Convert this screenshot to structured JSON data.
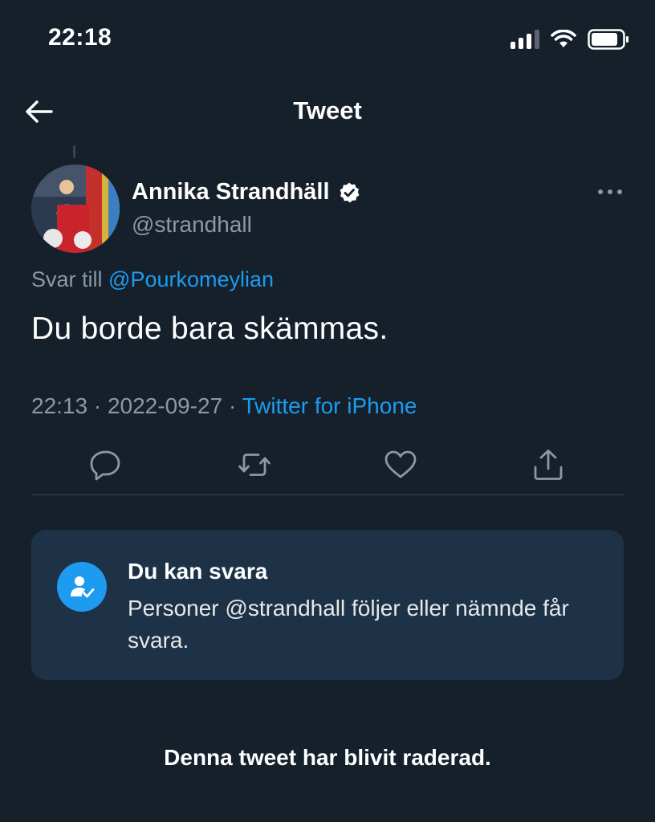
{
  "status_bar": {
    "time": "22:18"
  },
  "header": {
    "title": "Tweet",
    "back_icon": "arrow-left-icon"
  },
  "tweet": {
    "author_name": "Annika Strandhäll",
    "author_handle": "@strandhall",
    "verified": true,
    "reply_prefix": "Svar till",
    "reply_handle": "@Pourkomeylian",
    "text": "Du borde bara skämmas.",
    "time": "22:13",
    "separator": "·",
    "date": "2022-09-27",
    "source": "Twitter for iPhone"
  },
  "actions": {
    "reply_icon": "reply-icon",
    "retweet_icon": "retweet-icon",
    "like_icon": "heart-icon",
    "share_icon": "share-icon"
  },
  "reply_card": {
    "title": "Du kan svara",
    "body": "Personer @strandhall följer eller nämnde får svara."
  },
  "deleted_note": "Denna tweet har blivit raderad.",
  "colors": {
    "background": "#15202b",
    "accent": "#1d9bf0",
    "secondary_text": "#8b98a5",
    "card_background": "#1e3247"
  }
}
